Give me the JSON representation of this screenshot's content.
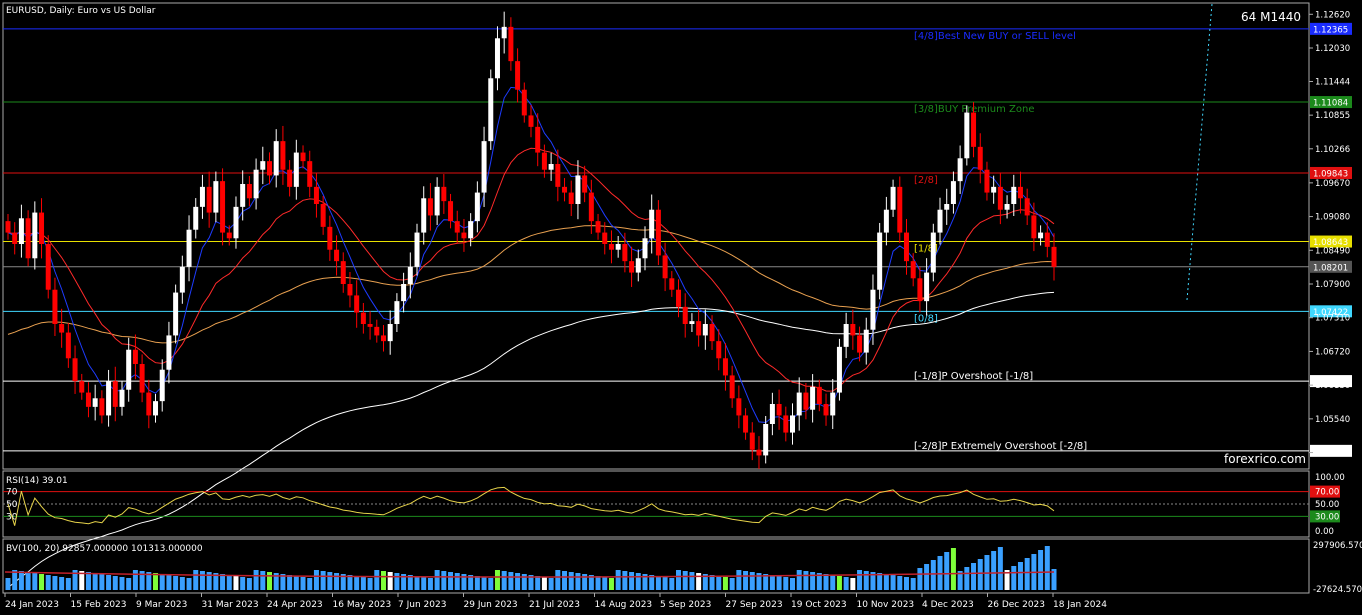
{
  "chart_title": "EURUSD, Daily:  Euro vs US Dollar",
  "timeframe_tag": "64 M1440",
  "watermark": "forexrico.com",
  "colors": {
    "up": "#ffffff",
    "down": "#ff0000",
    "ema_fast": "#1e3cff",
    "ema_mid": "#ff2a2a",
    "ma_200": "#e8a050",
    "ma_white": "#ffffff",
    "rsi": "#e6d34a"
  },
  "levels": [
    {
      "label": "[4/8]Best New BUY or SELL level",
      "price": "1.12365",
      "value": 1.12365,
      "color": "#1a2cff",
      "tag_bg": "#1a2cff"
    },
    {
      "label": "[3/8]BUY Premium Zone",
      "price": "1.11084",
      "value": 1.11084,
      "color": "#1c8a1c",
      "tag_bg": "#1c8a1c"
    },
    {
      "label": "[2/8]",
      "price": "1.09843",
      "value": 1.09843,
      "color": "#e01010",
      "tag_bg": "#e01010"
    },
    {
      "label": "[1/8]",
      "price": "1.08643",
      "value": 1.08643,
      "color": "#e8e000",
      "tag_bg": "#e8e000"
    },
    {
      "label": "",
      "price": "1.08201",
      "value": 1.08201,
      "color": "#888888",
      "tag_bg": "#555555"
    },
    {
      "label": "[0/8]",
      "price": "1.07422",
      "value": 1.07422,
      "color": "#40d8ff",
      "tag_bg": "#40d8ff"
    },
    {
      "label": "[-1/8]P Overshoot [-1/8]",
      "price": "1.06201",
      "value": 1.06201,
      "color": "#ffffff",
      "tag_bg": "#ffffff"
    },
    {
      "label": "[-2/8]P Extremely Overshoot [-2/8]",
      "price": "1.04980",
      "value": 1.0498,
      "color": "#ffffff",
      "tag_bg": "#ffffff"
    }
  ],
  "price_axis_ticks": [
    "1.12620",
    "1.12030",
    "1.11444",
    "1.10855",
    "1.10266",
    "1.09670",
    "1.09080",
    "1.08490",
    "1.07900",
    "1.07310",
    "1.06720",
    "1.06130",
    "1.05540",
    "1.04950"
  ],
  "rsi": {
    "label": "RSI(14) 39.01",
    "value": 39.01,
    "levels": [
      "70",
      "50",
      "30"
    ],
    "axis": [
      "100.00",
      "70.00",
      "50.00",
      "30.00",
      "0.00"
    ]
  },
  "volume": {
    "label": "BV(100, 20) 92857.000000 101313.000000",
    "axis": [
      "297906.570",
      "-27624.570"
    ]
  },
  "date_axis": [
    "24 Jan 2023",
    "15 Feb 2023",
    "9 Mar 2023",
    "31 Mar 2023",
    "24 Apr 2023",
    "16 May 2023",
    "7 Jun 2023",
    "29 Jun 2023",
    "21 Jul 2023",
    "14 Aug 2023",
    "5 Sep 2023",
    "27 Sep 2023",
    "19 Oct 2023",
    "10 Nov 2023",
    "4 Dec 2023",
    "26 Dec 2023",
    "18 Jan 2024"
  ],
  "chart_data": {
    "type": "candlestick",
    "symbol": "EURUSD",
    "ylim": [
      1.0468,
      1.128
    ],
    "closes": [
      1.088,
      1.086,
      1.0905,
      1.0835,
      1.0915,
      1.086,
      1.078,
      1.072,
      1.0705,
      1.066,
      1.062,
      1.06,
      1.0575,
      1.059,
      1.056,
      1.062,
      1.0575,
      1.0605,
      1.0675,
      1.065,
      1.06,
      1.056,
      1.0585,
      1.064,
      1.07,
      1.0775,
      1.082,
      1.0885,
      1.0925,
      1.096,
      1.0915,
      1.097,
      1.088,
      1.087,
      1.0925,
      1.0965,
      1.094,
      1.099,
      1.1005,
      1.098,
      1.104,
      1.099,
      1.096,
      1.102,
      1.1005,
      1.096,
      1.093,
      1.089,
      1.085,
      1.083,
      1.079,
      1.077,
      1.074,
      1.072,
      1.0715,
      1.07,
      1.069,
      1.072,
      1.076,
      1.079,
      1.082,
      1.088,
      1.094,
      1.091,
      1.096,
      1.0935,
      1.09,
      1.088,
      1.087,
      1.09,
      1.095,
      1.104,
      1.115,
      1.122,
      1.124,
      1.118,
      1.113,
      1.1085,
      1.1065,
      1.102,
      1.099,
      1.1,
      1.096,
      1.095,
      1.093,
      1.098,
      1.095,
      1.09,
      1.088,
      1.086,
      1.085,
      1.086,
      1.083,
      1.081,
      1.0835,
      1.087,
      1.092,
      1.084,
      1.08,
      1.078,
      1.075,
      1.072,
      1.0725,
      1.07,
      1.072,
      1.069,
      1.066,
      1.063,
      1.059,
      1.056,
      1.053,
      1.05,
      1.049,
      1.0545,
      1.058,
      1.056,
      1.053,
      1.056,
      1.06,
      1.057,
      1.061,
      1.058,
      1.056,
      1.06,
      1.068,
      1.072,
      1.07,
      1.067,
      1.071,
      1.078,
      1.088,
      1.092,
      1.096,
      1.088,
      1.083,
      1.08,
      1.076,
      1.081,
      1.088,
      1.092,
      1.093,
      1.097,
      1.101,
      1.109,
      1.103,
      1.099,
      1.095,
      1.096,
      1.092,
      1.093,
      1.096,
      1.094,
      1.091,
      1.087,
      1.088,
      1.0855,
      1.082
    ],
    "series": [
      {
        "name": "RSI(14)",
        "last": 39.01
      },
      {
        "name": "BV(100, 20)",
        "values": [
          92857.0,
          101313.0
        ]
      }
    ]
  }
}
